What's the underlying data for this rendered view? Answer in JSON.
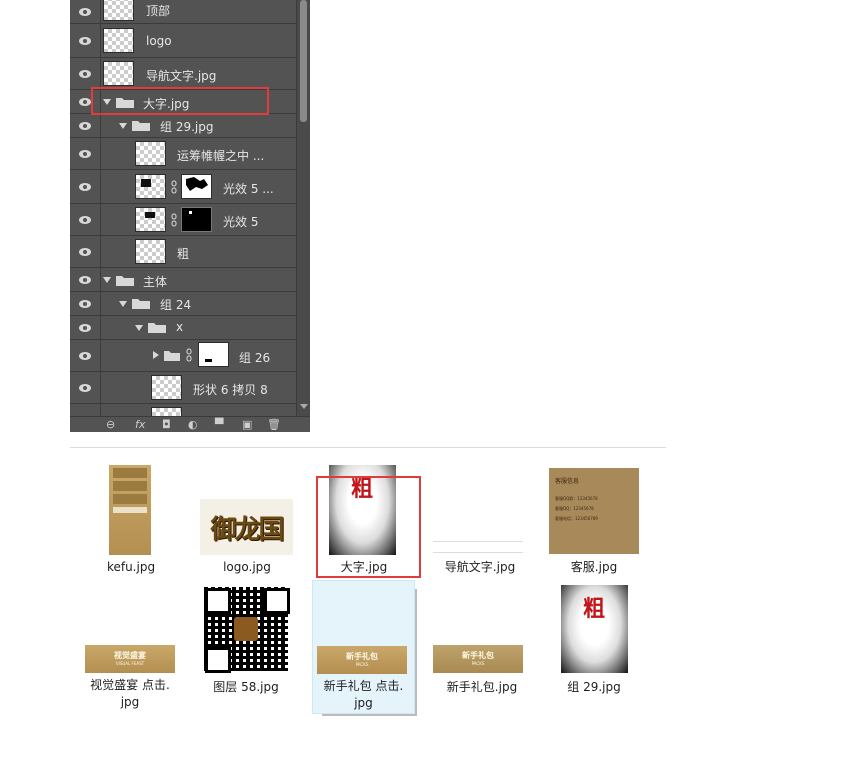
{
  "layers": [
    {
      "name": "顶部",
      "kind": "layer"
    },
    {
      "name": "logo",
      "kind": "layer"
    },
    {
      "name": "导航文字.jpg",
      "kind": "layer"
    },
    {
      "name": "大字.jpg",
      "kind": "group",
      "expanded": true
    },
    {
      "name": "组 29.jpg",
      "kind": "group",
      "expanded": true
    },
    {
      "name": "运筹帷幄之中 ...",
      "kind": "layer"
    },
    {
      "name": "光效 5 ...",
      "kind": "layer",
      "masked": true
    },
    {
      "name": "光效 5",
      "kind": "layer",
      "masked": true
    },
    {
      "name": "粗",
      "kind": "layer"
    },
    {
      "name": "主体",
      "kind": "group",
      "expanded": true
    },
    {
      "name": "组 24",
      "kind": "group",
      "expanded": true
    },
    {
      "name": "x",
      "kind": "group",
      "expanded": true
    },
    {
      "name": "组 26",
      "kind": "group",
      "expanded": false,
      "masked": true
    },
    {
      "name": "形状 6 拷贝 8",
      "kind": "shape"
    }
  ],
  "footer_buttons": [
    "link-icon",
    "fx-icon",
    "mask-icon",
    "adjustment-icon",
    "new-group-icon",
    "new-layer-icon",
    "trash-icon"
  ],
  "footer_labels": {
    "link": "⊖",
    "fx": "fx",
    "mask": "◘",
    "adjust": "◐",
    "folder": "▀",
    "new": "▣",
    "trash": "🗑"
  },
  "files": [
    {
      "name": "kefu.jpg",
      "thumb": "kefu"
    },
    {
      "name": "logo.jpg",
      "thumb": "logo"
    },
    {
      "name": "大字.jpg",
      "thumb": "dazi"
    },
    {
      "name": "导航文字.jpg",
      "thumb": "nav"
    },
    {
      "name": "客服.jpg",
      "thumb": "kefu2"
    },
    {
      "name": "视觉盛宴 点击.jpg",
      "thumb": "banner"
    },
    {
      "name": "图层 58.jpg",
      "thumb": "qr"
    },
    {
      "name": "新手礼包 点击.jpg",
      "thumb": "gift"
    },
    {
      "name": "新手礼包.jpg",
      "thumb": "gift2"
    },
    {
      "name": "组 29.jpg",
      "thumb": "dazi2"
    }
  ],
  "thumb_text": {
    "logo": "御龙国",
    "dazi": "粗",
    "banner": "视觉盛宴",
    "banner_sub": "VISUAL FEAST",
    "gift": "新手礼包",
    "gift_sub": "PACKS",
    "kefu_lines": [
      "客服中心",
      "在线客服",
      "客服热线"
    ],
    "kefu2_title": "客服信息",
    "kefu2_lines": [
      "客服QQ群：12345678",
      "客服QQ：12345678",
      "客服电话：123456789"
    ]
  },
  "label_lines": {
    "banner_l1": "视觉盛宴 点击.",
    "banner_l2": "jpg",
    "gift_l1": "新手礼包 点击.",
    "gift_l2": "jpg"
  },
  "colors": {
    "panel_bg": "#535353",
    "highlight": "#e23b3b",
    "selection": "#e5f3fb"
  }
}
